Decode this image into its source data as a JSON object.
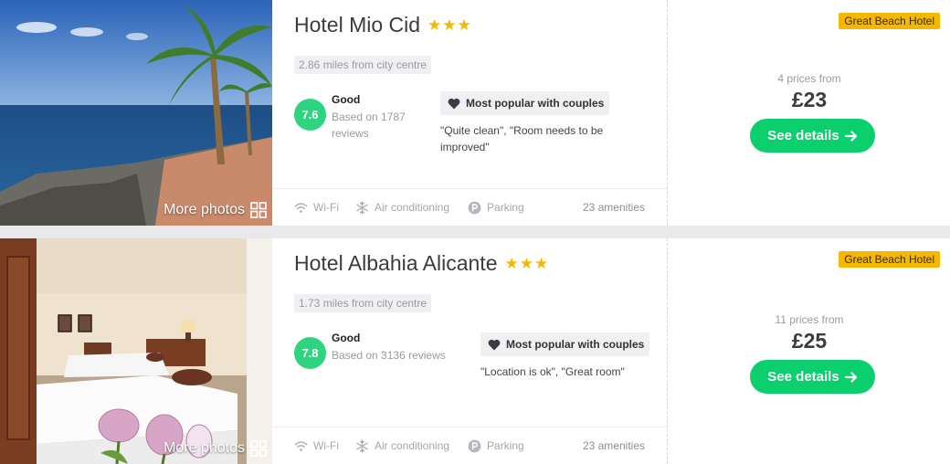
{
  "hotels": [
    {
      "name": "Hotel Mio Cid",
      "stars": "★★★",
      "distance": "2.86 miles from city centre",
      "score": "7.6",
      "rating_label": "Good",
      "rating_sub": "Based on 1787 reviews",
      "popular": "Most popular with couples",
      "quote": "\"Quite clean\", \"Room needs to be improved\"",
      "more_photos": "More photos",
      "amenities": [
        "Wi-Fi",
        "Air conditioning",
        "Parking"
      ],
      "amenities_count": "23 amenities",
      "tag": "Great Beach Hotel",
      "prices_from": "4 prices from",
      "price": "£23",
      "button": "See details"
    },
    {
      "name": "Hotel Albahia Alicante",
      "stars": "★★★",
      "distance": "1.73 miles from city centre",
      "score": "7.8",
      "rating_label": "Good",
      "rating_sub": "Based on 3136 reviews",
      "popular": "Most popular with couples",
      "quote": "\"Location is ok\", \"Great room\"",
      "more_photos": "More photos",
      "amenities": [
        "Wi-Fi",
        "Air conditioning",
        "Parking"
      ],
      "amenities_count": "23 amenities",
      "tag": "Great Beach Hotel",
      "prices_from": "11 prices from",
      "price": "£25",
      "button": "See details"
    }
  ],
  "icons": {
    "wifi": "wifi-icon",
    "ac": "snowflake-icon",
    "parking": "parking-icon",
    "heart": "heart-icon",
    "gallery": "gallery-grid-icon",
    "arrow": "arrow-right-icon"
  },
  "colors": {
    "accent_green": "#0bce6c",
    "score_green": "#2ed480",
    "star_yellow": "#f5b700",
    "tag_yellow": "#f5b700"
  }
}
